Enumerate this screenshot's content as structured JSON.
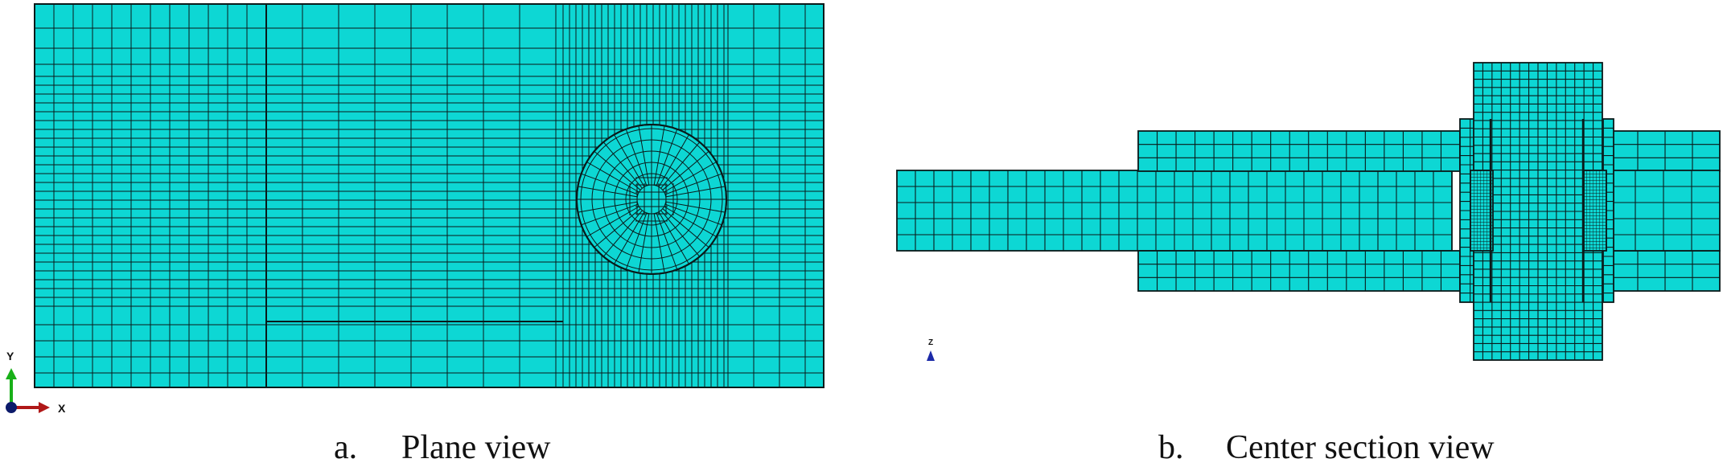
{
  "figure": {
    "colors": {
      "mesh_fill": "#0dd7d4",
      "mesh_line": "#0a1a1a",
      "axis_x": "#b01818",
      "axis_y": "#18b018",
      "axis_z": "#1c2aa8",
      "origin": "#0c1a6a"
    }
  },
  "panel_a": {
    "caption_letter": "a.",
    "caption_text": "Plane view",
    "triad": {
      "x_label": "X",
      "y_label": "Y"
    }
  },
  "panel_b": {
    "caption_letter": "b.",
    "caption_text": "Center section view",
    "triad": {
      "z_label": "Z"
    }
  }
}
